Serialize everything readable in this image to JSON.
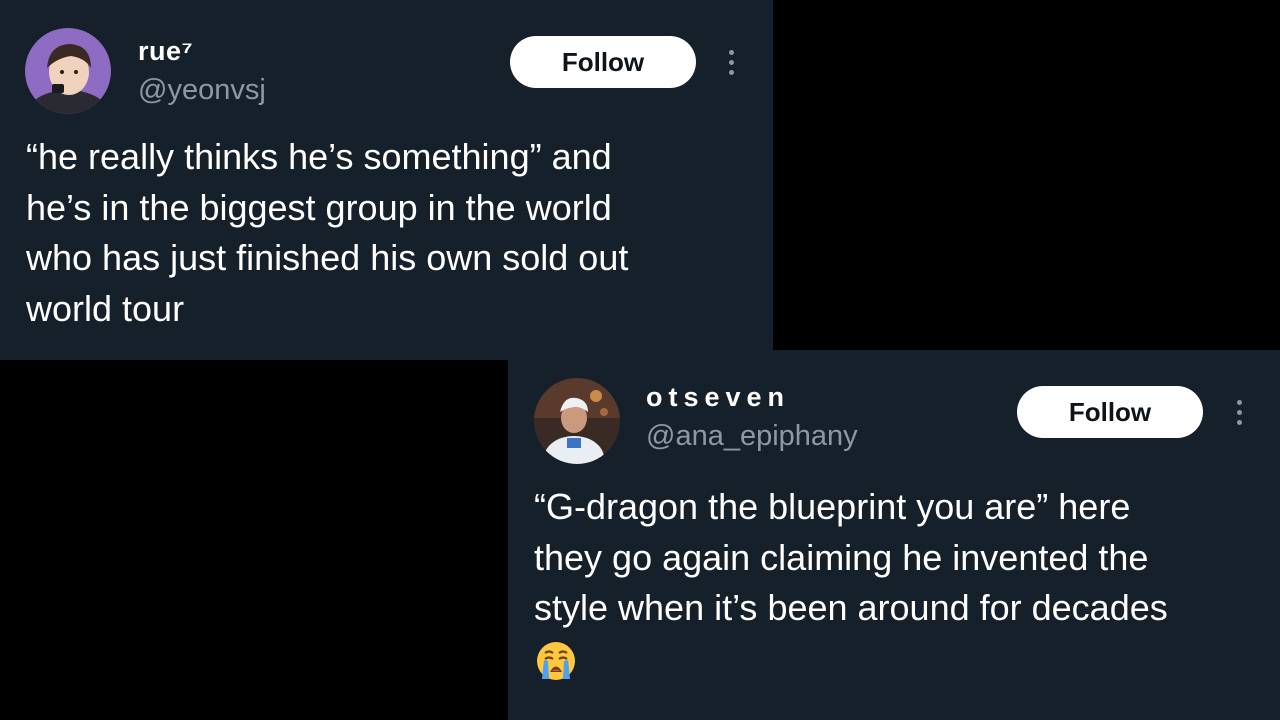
{
  "tweets": [
    {
      "display_name": "rue⁷",
      "handle": "@yeonvsj",
      "follow_label": "Follow",
      "more_icon": "more-vertical-icon",
      "avatar_icon": "profile-photo-avatar",
      "text_lines": [
        "“he really thinks he’s something” and",
        "he’s in the biggest group in the world",
        "who has just finished his own sold out",
        "world tour"
      ]
    },
    {
      "display_name": "otseven",
      "handle": "@ana_epiphany",
      "follow_label": "Follow",
      "more_icon": "more-vertical-icon",
      "avatar_icon": "profile-photo-avatar",
      "text_lines": [
        "“G-dragon the blueprint you are” here",
        "they go again claiming he invented the",
        "style when it’s been around for decades"
      ],
      "emoji": "loudly-crying-face-emoji"
    }
  ],
  "colors": {
    "card_background": "#16202b",
    "page_background": "#000000",
    "text_primary": "#ffffff",
    "text_secondary": "#8b98a5",
    "button_background": "#ffffff",
    "button_text": "#0f1419"
  }
}
